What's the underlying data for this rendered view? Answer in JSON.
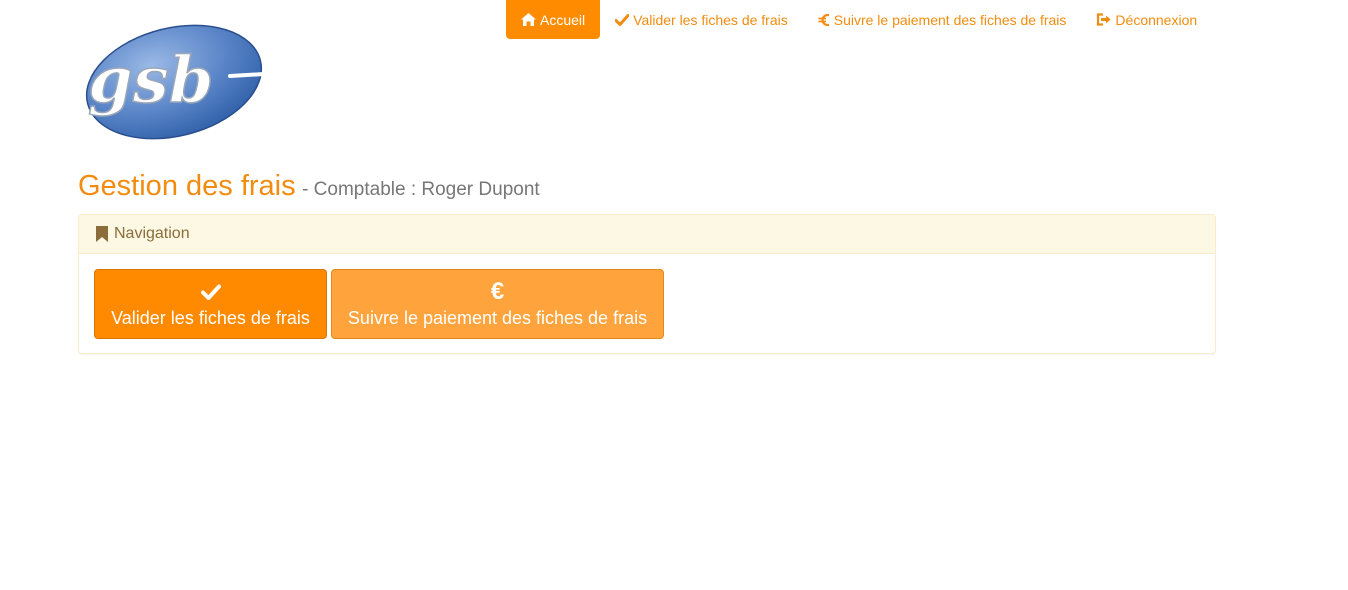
{
  "nav": {
    "items": [
      {
        "label": "Accueil",
        "icon": "home-icon",
        "active": true
      },
      {
        "label": "Valider les fiches de frais",
        "icon": "check-icon",
        "active": false
      },
      {
        "label": "Suivre le paiement des fiches de frais",
        "icon": "euro-icon",
        "active": false
      },
      {
        "label": "Déconnexion",
        "icon": "logout-icon",
        "active": false
      }
    ]
  },
  "logo": {
    "text": "gsb"
  },
  "heading": {
    "title": "Gestion des frais",
    "subtitle": "- Comptable : Roger Dupont"
  },
  "panel": {
    "title": "Navigation",
    "title_icon": "bookmark-icon",
    "buttons": [
      {
        "label": "Valider les fiches de frais",
        "icon": "check-icon"
      },
      {
        "label": "Suivre le paiement des fiches de frais",
        "icon": "euro-icon",
        "symbol": "€"
      }
    ]
  },
  "colors": {
    "accent": "#ff8c00",
    "accent_light": "#ffa33d",
    "nav_text": "#f28c0f",
    "panel_heading_bg": "#fcf8e3",
    "panel_heading_text": "#8a6d3b",
    "subtitle": "#777777"
  }
}
